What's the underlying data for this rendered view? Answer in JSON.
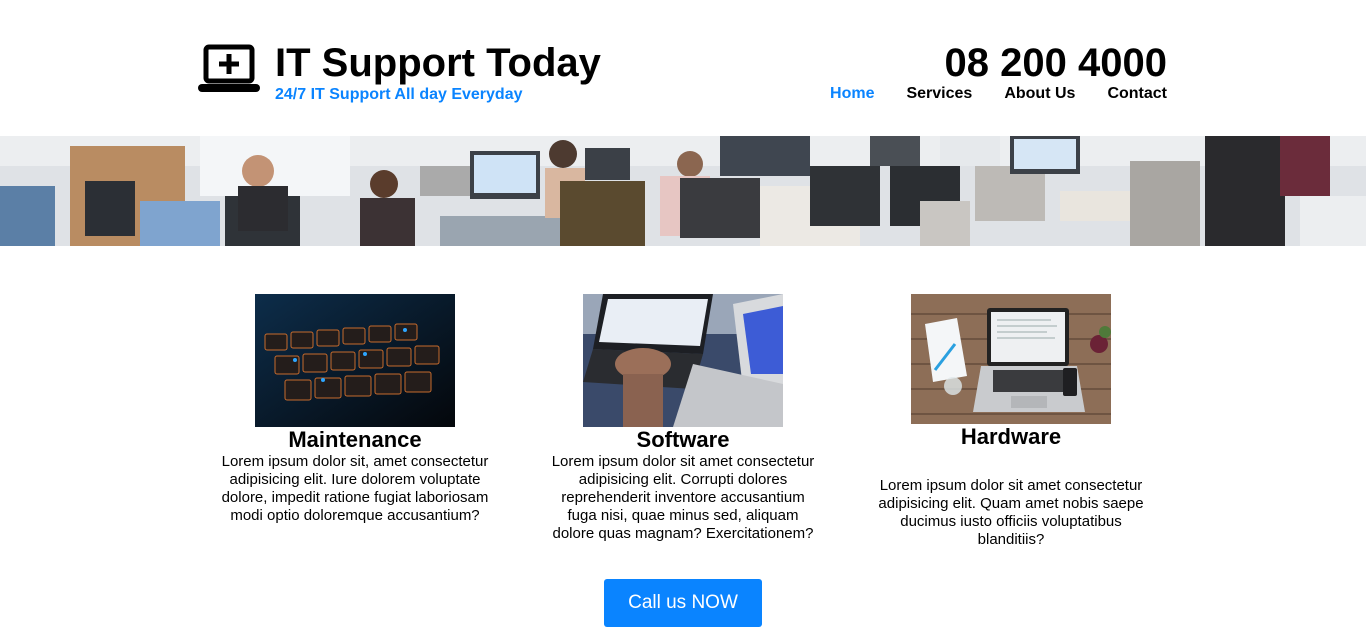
{
  "brand": {
    "title": "IT Support Today",
    "tagline": "24/7 IT Support All day Everyday",
    "icon": "laptop-plus-icon",
    "accent": "#0a84ff"
  },
  "contact": {
    "phone": "08 200 4000"
  },
  "nav": {
    "items": [
      {
        "label": "Home",
        "active": true
      },
      {
        "label": "Services",
        "active": false
      },
      {
        "label": "About Us",
        "active": false
      },
      {
        "label": "Contact",
        "active": false
      }
    ]
  },
  "services": [
    {
      "title": "Maintenance",
      "text": "Lorem ipsum dolor sit, amet consectetur adipisicing elit. Iure dolorem voluptate dolore, impedit ratione fugiat laboriosam modi optio doloremque accusantium?"
    },
    {
      "title": "Software",
      "text": "Lorem ipsum dolor sit amet consectetur adipisicing elit. Corrupti dolores reprehenderit inventore accusantium fuga nisi, quae minus sed, aliquam dolore quas magnam? Exercitationem?"
    },
    {
      "title": "Hardware",
      "text": "Lorem ipsum dolor sit amet consectetur adipisicing elit. Quam amet nobis saepe ducimus iusto officiis voluptatibus blanditiis?"
    }
  ],
  "cta": {
    "label": "Call us NOW"
  }
}
